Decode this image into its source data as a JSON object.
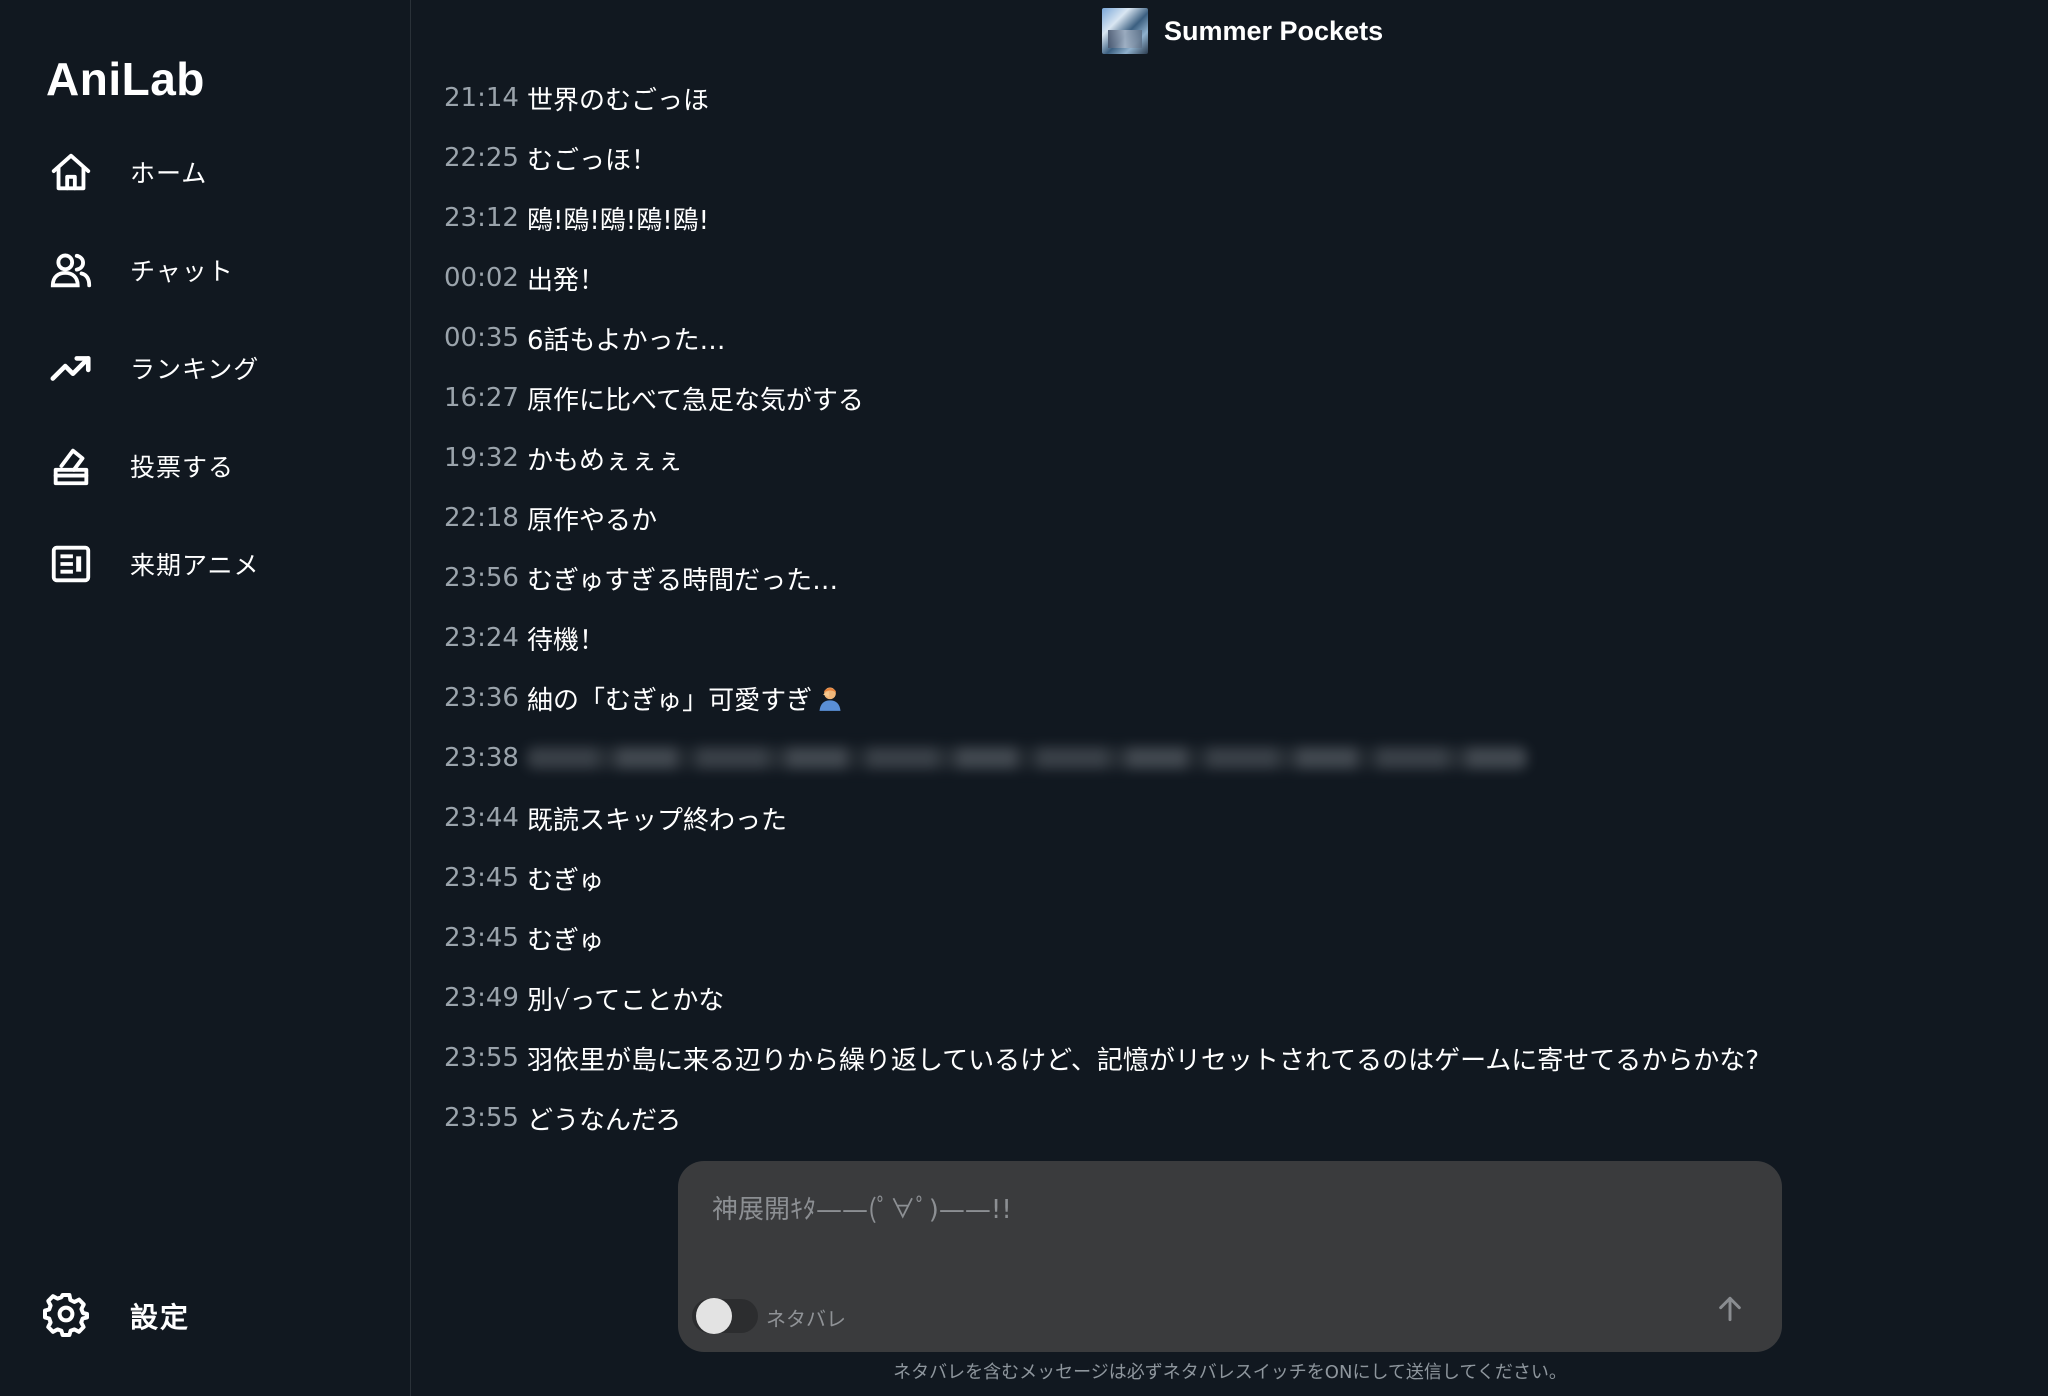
{
  "app": {
    "logo": "AniLab"
  },
  "sidebar": {
    "items": [
      {
        "label": "ホーム",
        "icon": "home-icon"
      },
      {
        "label": "チャット",
        "icon": "users-icon"
      },
      {
        "label": "ランキング",
        "icon": "trending-up-icon"
      },
      {
        "label": "投票する",
        "icon": "vote-box-icon"
      },
      {
        "label": "来期アニメ",
        "icon": "news-icon"
      }
    ],
    "settings": {
      "label": "設定",
      "icon": "gear-icon"
    }
  },
  "chat": {
    "title": "Summer Pockets",
    "messages": [
      {
        "time": "21:14",
        "text": "世界のむごっほ"
      },
      {
        "time": "22:25",
        "text": "むごっほ！"
      },
      {
        "time": "23:12",
        "text": "鴎!鴎!鴎!鴎!鴎!"
      },
      {
        "time": "00:02",
        "text": "出発！"
      },
      {
        "time": "00:35",
        "text": "6話もよかった…"
      },
      {
        "time": "16:27",
        "text": "原作に比べて急足な気がする"
      },
      {
        "time": "19:32",
        "text": "かもめぇぇぇ"
      },
      {
        "time": "22:18",
        "text": "原作やるか"
      },
      {
        "time": "23:56",
        "text": "むぎゅすぎる時間だった…"
      },
      {
        "time": "23:24",
        "text": "待機！"
      },
      {
        "time": "23:36",
        "text": "紬の「むぎゅ」可愛すぎ",
        "emoji": "person-facepalming-emoji"
      },
      {
        "time": "23:38",
        "text": "",
        "spoiler": true
      },
      {
        "time": "23:44",
        "text": "既読スキップ終わった"
      },
      {
        "time": "23:45",
        "text": "むぎゅ"
      },
      {
        "time": "23:45",
        "text": "むぎゅ"
      },
      {
        "time": "23:49",
        "text": "別√ってことかな"
      },
      {
        "time": "23:55",
        "text": "羽依里が島に来る辺りから繰り返しているけど、記憶がリセットされてるのはゲームに寄せてるからかな?"
      },
      {
        "time": "23:55",
        "text": "どうなんだろ"
      }
    ]
  },
  "composer": {
    "placeholder": "神展開ｷﾀ——(ﾟ∀ﾟ)——!!",
    "value": "",
    "spoiler_label": "ネタバレ",
    "spoiler_on": false,
    "notice": "ネタバレを含むメッセージは必ずネタバレスイッチをONにして送信してください。"
  }
}
